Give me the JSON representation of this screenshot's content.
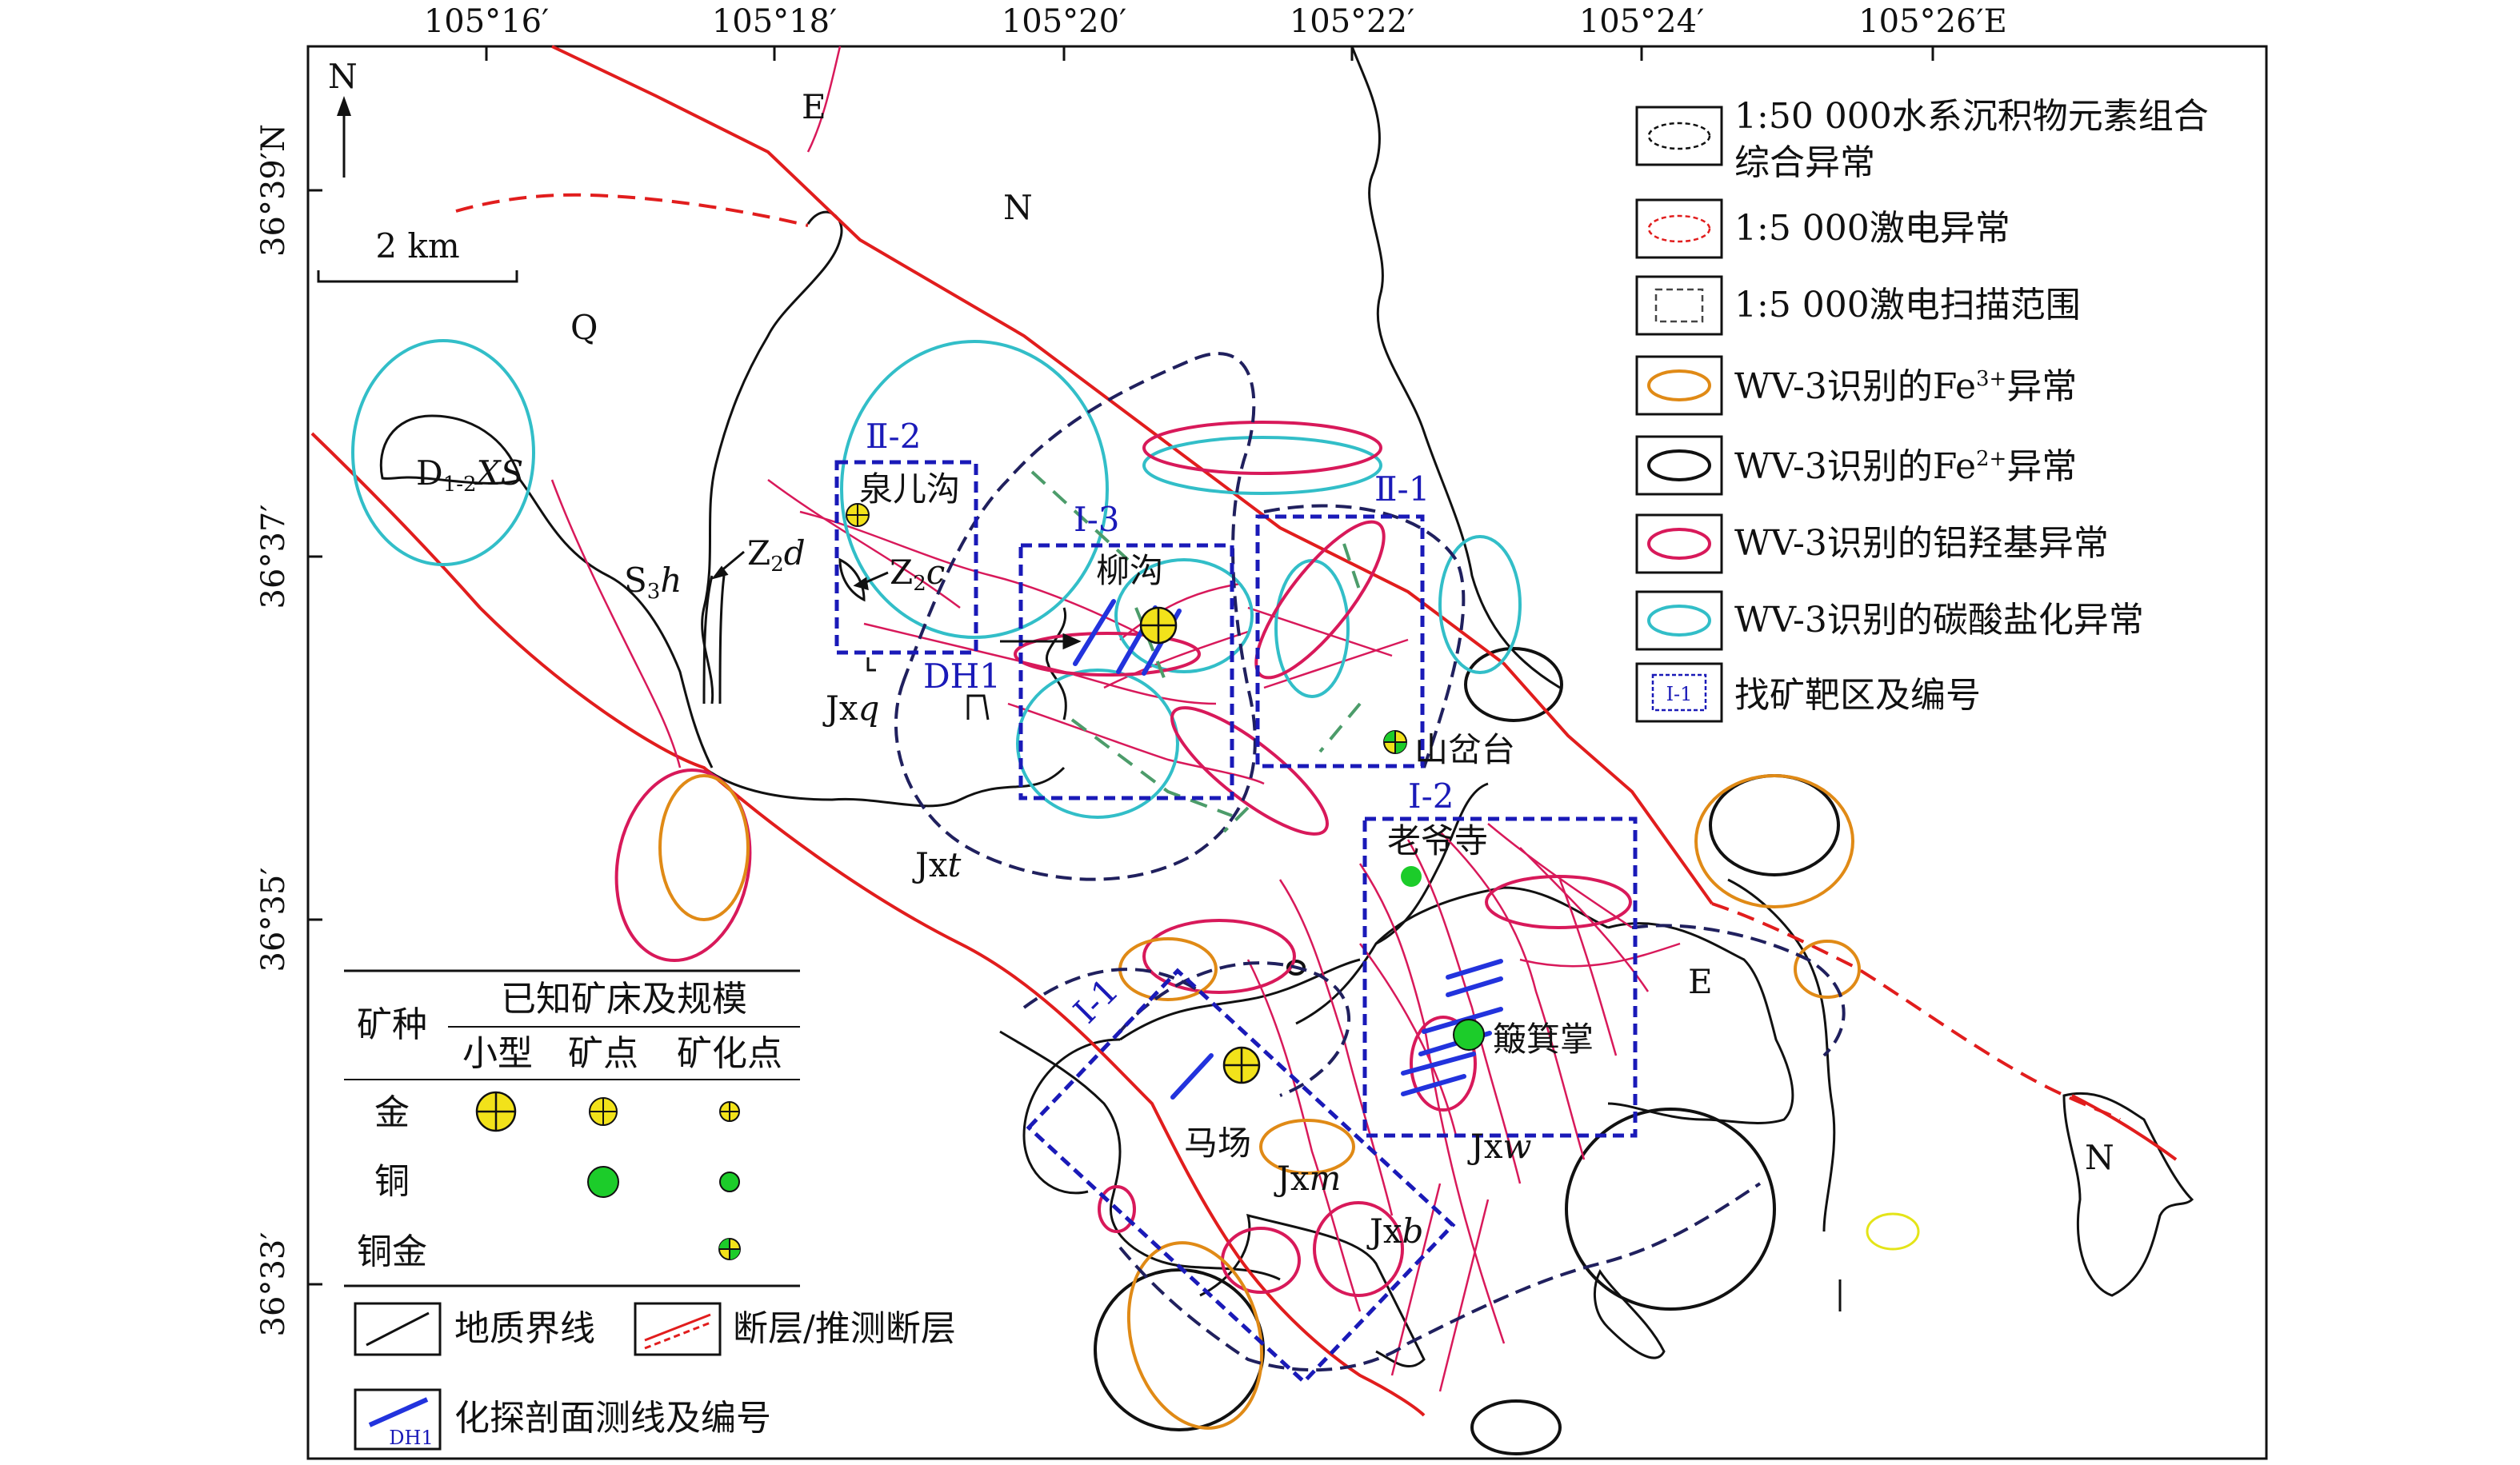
{
  "axes": {
    "longitude_ticks": [
      "105°16′",
      "105°18′",
      "105°20′",
      "105°22′",
      "105°24′",
      "105°26′E"
    ],
    "latitude_ticks": [
      "36°39′N",
      "36°37′",
      "36°35′",
      "36°33′"
    ]
  },
  "north_arrow": "N",
  "scale_bar": "2 km",
  "geology_labels": {
    "E_top": "E",
    "N_top": "N",
    "Q": "Q",
    "D12XS_main": "D",
    "D12XS_sub": "1-2",
    "D12XS_it": "XS",
    "S3h_main": "S",
    "S3h_sub": "3",
    "S3h_it": "h",
    "Z2d_main": "Z",
    "Z2d_sub": "2",
    "Z2d_it": "d",
    "Z2c_main": "Z",
    "Z2c_sub": "2",
    "Z2c_it": "c",
    "Jxq_main": "Jx",
    "Jxq_it": "q",
    "Jxt_main": "Jx",
    "Jxt_it": "t",
    "Jxm_main": "Jx",
    "Jxm_it": "m",
    "Jxw_main": "Jx",
    "Jxw_it": "w",
    "Jxb_main": "Jx",
    "Jxb_it": "b",
    "E_right": "E",
    "N_right": "N"
  },
  "place_names": {
    "quanergou": "泉儿沟",
    "liugou": "柳沟",
    "shanpentai": "山岔台",
    "laoyesi": "老爷寺",
    "bojizhang": "簸箕掌",
    "machang": "马场"
  },
  "targets": {
    "II2": "Ⅱ-2",
    "I3": "Ⅰ-3",
    "II1": "Ⅱ-1",
    "I2": "Ⅰ-2",
    "I1": "Ⅰ-1",
    "DH1": "DH1"
  },
  "legend": {
    "items": [
      {
        "text_1": "1:50 000水系沉积物元素组合",
        "text_2": "综合异常"
      },
      {
        "text_1": "1:5 000激电异常"
      },
      {
        "text_1": "1:5 000激电扫描范围"
      },
      {
        "text_1": "WV-3识别的Fe",
        "sup": "3+",
        "text_2": "异常"
      },
      {
        "text_1": "WV-3识别的Fe",
        "sup": "2+",
        "text_2": "异常"
      },
      {
        "text_1": "WV-3识别的铝羟基异常"
      },
      {
        "text_1": "WV-3识别的碳酸盐化异常"
      },
      {
        "text_1": "找矿靶区及编号",
        "icon_label": "Ⅰ-1"
      }
    ]
  },
  "deposit_table": {
    "col_mineral": "矿种",
    "col_header": "已知矿床及规模",
    "sub_headers": [
      "小型",
      "矿点",
      "矿化点"
    ],
    "rows": [
      "金",
      "铜",
      "铜金"
    ]
  },
  "line_legend": {
    "geo_boundary": "地质界线",
    "fault": "断层/推测断层",
    "profile": "化探剖面测线及编号",
    "profile_icon_label": "DH1"
  },
  "colors": {
    "fault_red": "#e11d1d",
    "alhydroxyl": "#d8195a",
    "carbonate": "#32bec8",
    "fe3": "#e08a16",
    "fe2": "#111111",
    "target_blue": "#1a1ab8",
    "profile_blue": "#2233dd",
    "gold": "#f2e21a",
    "copper": "#1ccc2a",
    "navy": "#20205e",
    "green_dash": "#4c9c6a"
  }
}
